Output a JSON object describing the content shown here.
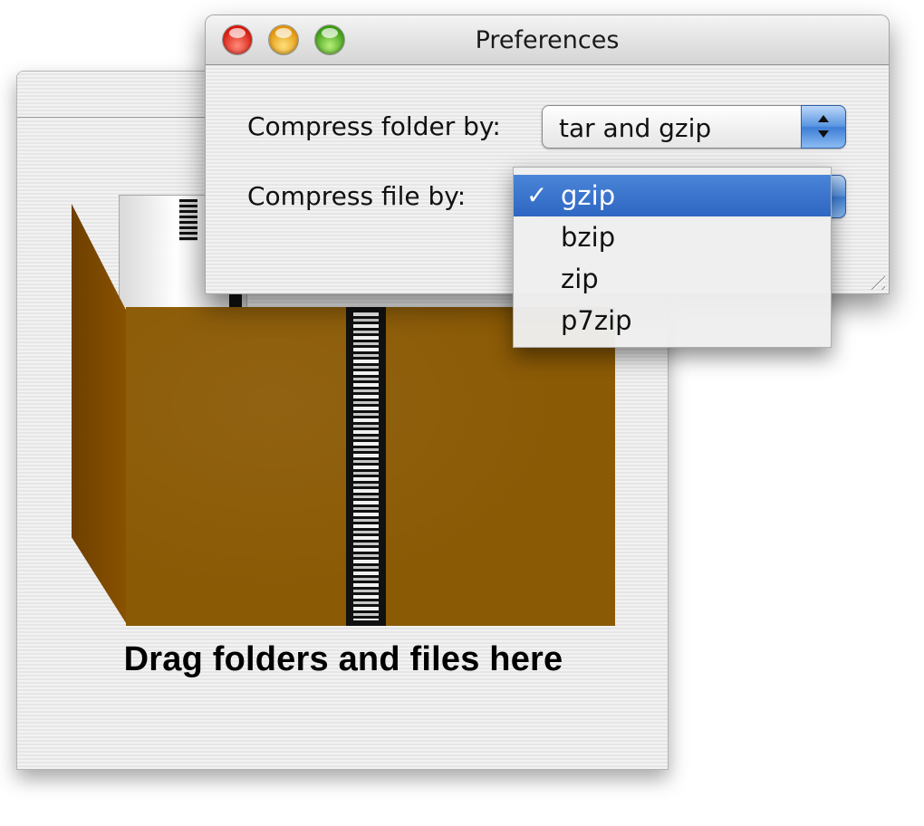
{
  "main_window": {
    "drop_label": "Drag folders and files here"
  },
  "preferences": {
    "title": "Preferences",
    "folder_label": "Compress folder by:",
    "folder_value": "tar and gzip",
    "file_label": "Compress file by:",
    "file_value": "gzip"
  },
  "file_menu": {
    "check_mark": "✓",
    "items": [
      "gzip",
      "bzip",
      "zip",
      "p7zip"
    ],
    "selected": "gzip"
  },
  "colors": {
    "folder_brown": "#8b5a05",
    "menu_highlight": "#3a74cf",
    "close": "#d6190c",
    "minimize": "#e0940a",
    "zoom": "#3c9b14"
  }
}
